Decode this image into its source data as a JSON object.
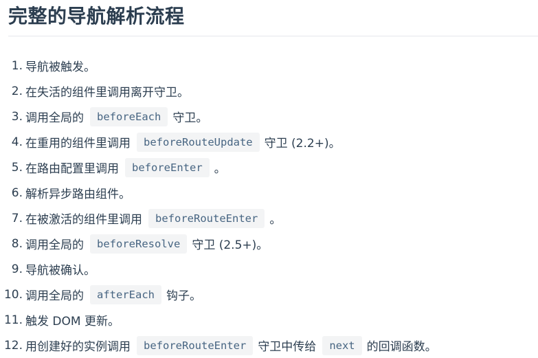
{
  "title": "完整的导航解析流程",
  "steps": [
    {
      "num": "1.",
      "before": "导航被触发。"
    },
    {
      "num": "2.",
      "before": "在失活的组件里调用离开守卫。"
    },
    {
      "num": "3.",
      "before": "调用全局的",
      "code": "beforeEach",
      "after": "守卫。"
    },
    {
      "num": "4.",
      "before": "在重用的组件里调用",
      "code": "beforeRouteUpdate",
      "after": "守卫 (2.2+)。"
    },
    {
      "num": "5.",
      "before": "在路由配置里调用",
      "code": "beforeEnter",
      "after": "。"
    },
    {
      "num": "6.",
      "before": "解析异步路由组件。"
    },
    {
      "num": "7.",
      "before": "在被激活的组件里调用",
      "code": "beforeRouteEnter",
      "after": "。"
    },
    {
      "num": "8.",
      "before": "调用全局的",
      "code": "beforeResolve",
      "after": "守卫 (2.5+)。"
    },
    {
      "num": "9.",
      "before": "导航被确认。"
    },
    {
      "num": "10.",
      "before": "调用全局的",
      "code": "afterEach",
      "after": "钩子。"
    },
    {
      "num": "11.",
      "before": "触发 DOM 更新。"
    },
    {
      "num": "12.",
      "before": "用创建好的实例调用",
      "code": "beforeRouteEnter",
      "after": "守卫中传给",
      "code2": "next",
      "after2": "的回调函数。"
    }
  ]
}
